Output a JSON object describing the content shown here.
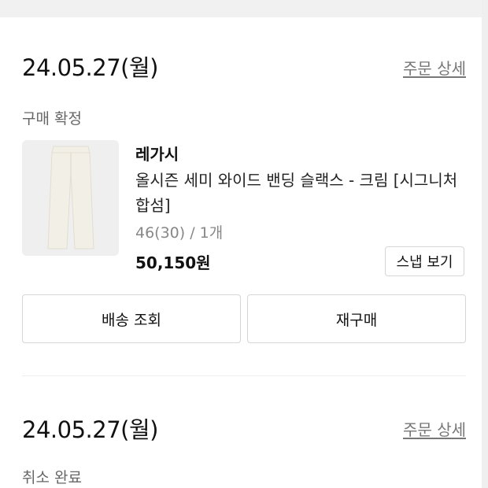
{
  "orders": [
    {
      "date": "24.05.27(월)",
      "detail_link": "주문 상세",
      "status": "구매 확정",
      "item": {
        "image_icon": "pants-product-image",
        "brand": "레가시",
        "name": "올시즌 세미 와이드 밴딩 슬랙스 - 크림 [시그니처 합섬]",
        "option": "46(30) / 1개",
        "price": "50,150원",
        "snap_label": "스냅 보기"
      },
      "actions": {
        "tracking_label": "배송 조회",
        "reorder_label": "재구매"
      }
    },
    {
      "date": "24.05.27(월)",
      "detail_link": "주문 상세",
      "status": "취소 완료"
    }
  ],
  "colors": {
    "background": "#ffffff",
    "top_band": "#f1f1f1",
    "thumbnail_bg": "#efefef",
    "product_cream": "#f2efe6",
    "button_border": "#d6d6d6",
    "muted_text": "#888888"
  }
}
